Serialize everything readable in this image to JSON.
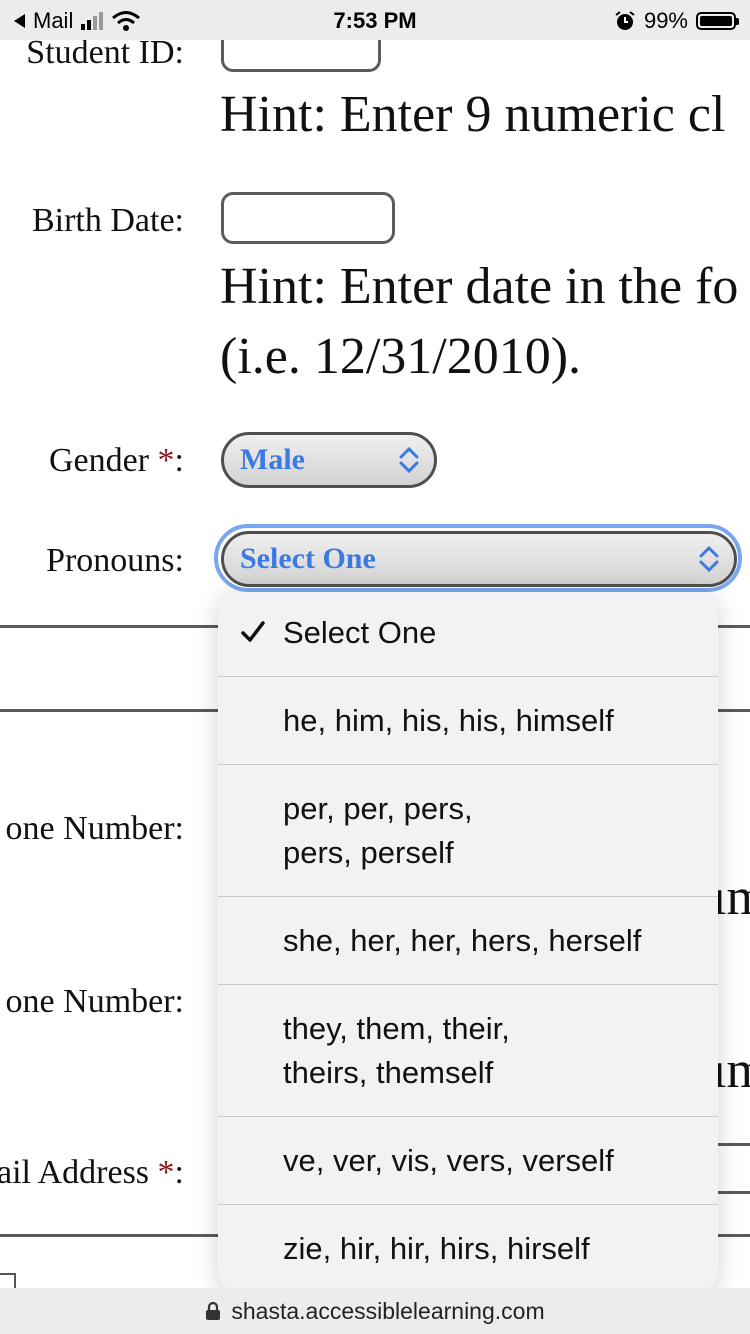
{
  "status": {
    "back_app": "Mail",
    "time": "7:53 PM",
    "battery": "99%",
    "battery_level": 0.99
  },
  "form": {
    "student_id_label": "Student ID:",
    "student_id_hint": "Hint: Enter 9 numeric cl",
    "birth_date_label": "Birth Date:",
    "birth_date_hint_line1": "Hint: Enter date in the fo",
    "birth_date_hint_line2": "(i.e. 12/31/2010).",
    "gender_label": "Gender ",
    "gender_value": "Male",
    "pronouns_label": "Pronouns:",
    "pronouns_value": "Select One",
    "required_mark": "*",
    "label_colon": ":",
    "phone1_label": "one Number:",
    "phone2_label": "one Number:",
    "email_label": "ail Address ",
    "clipped_right_1": "ım",
    "clipped_right_2": "ım"
  },
  "dropdown": {
    "options": [
      {
        "line1": "Select One",
        "line2": "",
        "selected": true
      },
      {
        "line1": "he, him, his, his, himself",
        "line2": ""
      },
      {
        "line1": "per, per, pers,",
        "line2": "pers, perself"
      },
      {
        "line1": "she, her, her, hers, herself",
        "line2": ""
      },
      {
        "line1": "they, them, their,",
        "line2": "theirs, themself"
      },
      {
        "line1": "ve, ver, vis, vers, verself",
        "line2": ""
      },
      {
        "line1": "zie, hir, hir, hirs, hirself",
        "line2": ""
      }
    ]
  },
  "url": "shasta.accessiblelearning.com",
  "colors": {
    "accent": "#3b7ae0",
    "required": "#8b1a1a",
    "focus": "#78a6f0"
  }
}
